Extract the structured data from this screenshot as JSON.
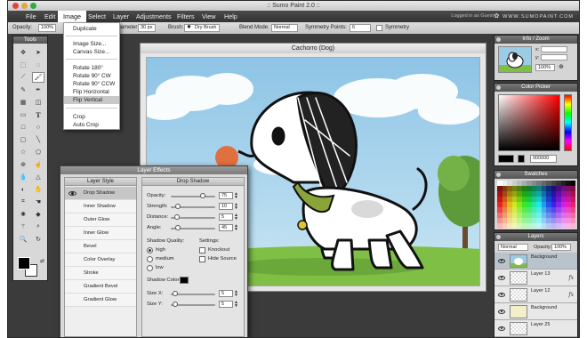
{
  "window": {
    "title": ":: Sumo Paint 2.0 ::"
  },
  "menubar": {
    "items": [
      "File",
      "Edit",
      "Image",
      "Select",
      "Layer",
      "Adjustments",
      "Filters",
      "View",
      "Help"
    ],
    "active": "Image",
    "logged_in": "Logged in as Guest",
    "brand": "WWW.SUMOPAINT.COM"
  },
  "options": {
    "opacity_label": "Opacity:",
    "opacity_value": "100%",
    "diameter_label": "Diameter:",
    "diameter_value": "30 px",
    "brush_label": "Brush:",
    "brush_value": "Dry Brush",
    "blend_label": "Blend Mode:",
    "blend_value": "Normal",
    "symmetry_label": "Symmetry Points:",
    "symmetry_value": "6",
    "symmetry_check_label": "Symmetry"
  },
  "tools": {
    "title": "Tools"
  },
  "image_menu": {
    "items": [
      "Duplicate",
      "Image Size...",
      "Canvas Size...",
      "Rotate 180°",
      "Rotate 90° CW",
      "Rotate 90° CCW",
      "Flip Horizontal",
      "Flip Vertical",
      "Crop",
      "Auto Crop"
    ],
    "highlighted": "Flip Vertical"
  },
  "document": {
    "title": "Cachorro (Dog)"
  },
  "layer_effects": {
    "title": "Layer Effects",
    "style_header": "Layer Style",
    "styles": [
      "Drop Shadow",
      "Inner Shadow",
      "Outer Glow",
      "Inner Glow",
      "Bevel",
      "Color Overlay",
      "Stroke",
      "Gradient Bevel",
      "Gradient Glow"
    ],
    "selected_style": "Drop Shadow",
    "drop_shadow": {
      "header": "Drop Shadow",
      "params": [
        {
          "label": "Opacity:",
          "value": "75",
          "level": 0.75
        },
        {
          "label": "Strength:",
          "value": "10",
          "level": 0.12
        },
        {
          "label": "Distance:",
          "value": "5",
          "level": 0.08
        },
        {
          "label": "Angle:",
          "value": "45",
          "level": 0.12
        }
      ],
      "quality_label": "Shadow Quality:",
      "quality_options": [
        "high",
        "medium",
        "low"
      ],
      "quality_selected": "high",
      "settings_label": "Settings:",
      "knockout_label": "Knockout",
      "hide_source_label": "Hide Source",
      "color_label": "Shadow Color:",
      "shadow_color": "#000000",
      "size_x_label": "Size X:",
      "size_x_value": "5",
      "size_y_label": "Size Y:",
      "size_y_value": "5"
    }
  },
  "info_panel": {
    "title": "Info / Zoom",
    "x_label": "x:",
    "y_label": "y:",
    "zoom_value": "100%"
  },
  "color_picker": {
    "title": "Color Picker",
    "hex_value": "000000"
  },
  "swatches": {
    "title": "Swatches"
  },
  "layers": {
    "title": "Layers",
    "blend_value": "Normal",
    "opacity_label": "Opacity:",
    "opacity_value": "100%",
    "items": [
      {
        "name": "Background",
        "fx": false,
        "selected": true
      },
      {
        "name": "Layer 13",
        "fx": true,
        "selected": false
      },
      {
        "name": "Layer 12",
        "fx": true,
        "selected": false
      },
      {
        "name": "Background",
        "fx": false,
        "selected": false
      },
      {
        "name": "Layer 25",
        "fx": false,
        "selected": false
      }
    ]
  },
  "colors": {
    "accent": "#b9c3cc",
    "panel_header": "#666666",
    "menu_bg": "#3a3a3a"
  }
}
